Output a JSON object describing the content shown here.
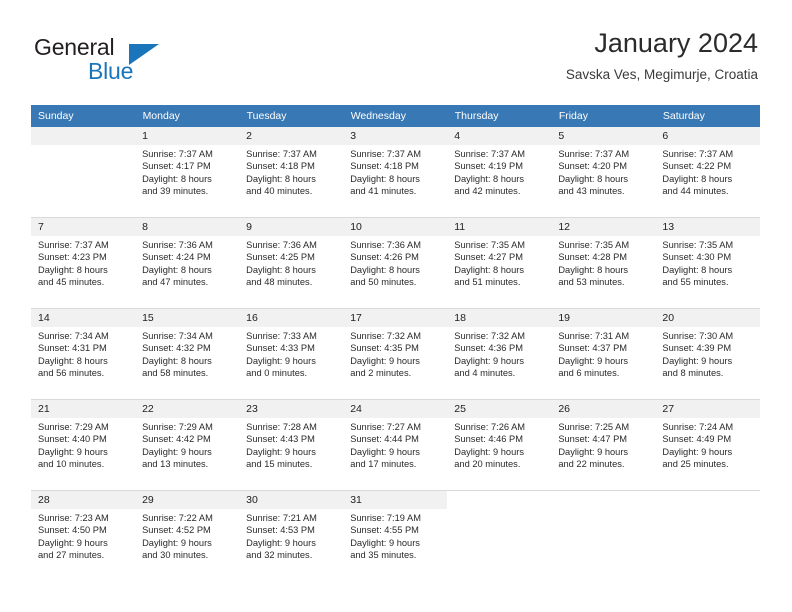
{
  "brand": {
    "word1": "General",
    "word2": "Blue",
    "triangle_color": "#1b75bb",
    "logo_icon": "general-blue-logo-icon"
  },
  "header": {
    "title": "January 2024",
    "subtitle": "Savska Ves, Megimurje, Croatia"
  },
  "theme": {
    "header_row_bg": "#3878b4",
    "header_row_text": "#ffffff",
    "daynum_bg": "#f1f1f1",
    "grid_line": "#d9d9d9",
    "body_text": "#2a2a2a"
  },
  "weekdays": [
    "Sunday",
    "Monday",
    "Tuesday",
    "Wednesday",
    "Thursday",
    "Friday",
    "Saturday"
  ],
  "weeks": [
    [
      {
        "day": "",
        "lines": []
      },
      {
        "day": "1",
        "lines": [
          "Sunrise: 7:37 AM",
          "Sunset: 4:17 PM",
          "Daylight: 8 hours",
          "and 39 minutes."
        ]
      },
      {
        "day": "2",
        "lines": [
          "Sunrise: 7:37 AM",
          "Sunset: 4:18 PM",
          "Daylight: 8 hours",
          "and 40 minutes."
        ]
      },
      {
        "day": "3",
        "lines": [
          "Sunrise: 7:37 AM",
          "Sunset: 4:18 PM",
          "Daylight: 8 hours",
          "and 41 minutes."
        ]
      },
      {
        "day": "4",
        "lines": [
          "Sunrise: 7:37 AM",
          "Sunset: 4:19 PM",
          "Daylight: 8 hours",
          "and 42 minutes."
        ]
      },
      {
        "day": "5",
        "lines": [
          "Sunrise: 7:37 AM",
          "Sunset: 4:20 PM",
          "Daylight: 8 hours",
          "and 43 minutes."
        ]
      },
      {
        "day": "6",
        "lines": [
          "Sunrise: 7:37 AM",
          "Sunset: 4:22 PM",
          "Daylight: 8 hours",
          "and 44 minutes."
        ]
      }
    ],
    [
      {
        "day": "7",
        "lines": [
          "Sunrise: 7:37 AM",
          "Sunset: 4:23 PM",
          "Daylight: 8 hours",
          "and 45 minutes."
        ]
      },
      {
        "day": "8",
        "lines": [
          "Sunrise: 7:36 AM",
          "Sunset: 4:24 PM",
          "Daylight: 8 hours",
          "and 47 minutes."
        ]
      },
      {
        "day": "9",
        "lines": [
          "Sunrise: 7:36 AM",
          "Sunset: 4:25 PM",
          "Daylight: 8 hours",
          "and 48 minutes."
        ]
      },
      {
        "day": "10",
        "lines": [
          "Sunrise: 7:36 AM",
          "Sunset: 4:26 PM",
          "Daylight: 8 hours",
          "and 50 minutes."
        ]
      },
      {
        "day": "11",
        "lines": [
          "Sunrise: 7:35 AM",
          "Sunset: 4:27 PM",
          "Daylight: 8 hours",
          "and 51 minutes."
        ]
      },
      {
        "day": "12",
        "lines": [
          "Sunrise: 7:35 AM",
          "Sunset: 4:28 PM",
          "Daylight: 8 hours",
          "and 53 minutes."
        ]
      },
      {
        "day": "13",
        "lines": [
          "Sunrise: 7:35 AM",
          "Sunset: 4:30 PM",
          "Daylight: 8 hours",
          "and 55 minutes."
        ]
      }
    ],
    [
      {
        "day": "14",
        "lines": [
          "Sunrise: 7:34 AM",
          "Sunset: 4:31 PM",
          "Daylight: 8 hours",
          "and 56 minutes."
        ]
      },
      {
        "day": "15",
        "lines": [
          "Sunrise: 7:34 AM",
          "Sunset: 4:32 PM",
          "Daylight: 8 hours",
          "and 58 minutes."
        ]
      },
      {
        "day": "16",
        "lines": [
          "Sunrise: 7:33 AM",
          "Sunset: 4:33 PM",
          "Daylight: 9 hours",
          "and 0 minutes."
        ]
      },
      {
        "day": "17",
        "lines": [
          "Sunrise: 7:32 AM",
          "Sunset: 4:35 PM",
          "Daylight: 9 hours",
          "and 2 minutes."
        ]
      },
      {
        "day": "18",
        "lines": [
          "Sunrise: 7:32 AM",
          "Sunset: 4:36 PM",
          "Daylight: 9 hours",
          "and 4 minutes."
        ]
      },
      {
        "day": "19",
        "lines": [
          "Sunrise: 7:31 AM",
          "Sunset: 4:37 PM",
          "Daylight: 9 hours",
          "and 6 minutes."
        ]
      },
      {
        "day": "20",
        "lines": [
          "Sunrise: 7:30 AM",
          "Sunset: 4:39 PM",
          "Daylight: 9 hours",
          "and 8 minutes."
        ]
      }
    ],
    [
      {
        "day": "21",
        "lines": [
          "Sunrise: 7:29 AM",
          "Sunset: 4:40 PM",
          "Daylight: 9 hours",
          "and 10 minutes."
        ]
      },
      {
        "day": "22",
        "lines": [
          "Sunrise: 7:29 AM",
          "Sunset: 4:42 PM",
          "Daylight: 9 hours",
          "and 13 minutes."
        ]
      },
      {
        "day": "23",
        "lines": [
          "Sunrise: 7:28 AM",
          "Sunset: 4:43 PM",
          "Daylight: 9 hours",
          "and 15 minutes."
        ]
      },
      {
        "day": "24",
        "lines": [
          "Sunrise: 7:27 AM",
          "Sunset: 4:44 PM",
          "Daylight: 9 hours",
          "and 17 minutes."
        ]
      },
      {
        "day": "25",
        "lines": [
          "Sunrise: 7:26 AM",
          "Sunset: 4:46 PM",
          "Daylight: 9 hours",
          "and 20 minutes."
        ]
      },
      {
        "day": "26",
        "lines": [
          "Sunrise: 7:25 AM",
          "Sunset: 4:47 PM",
          "Daylight: 9 hours",
          "and 22 minutes."
        ]
      },
      {
        "day": "27",
        "lines": [
          "Sunrise: 7:24 AM",
          "Sunset: 4:49 PM",
          "Daylight: 9 hours",
          "and 25 minutes."
        ]
      }
    ],
    [
      {
        "day": "28",
        "lines": [
          "Sunrise: 7:23 AM",
          "Sunset: 4:50 PM",
          "Daylight: 9 hours",
          "and 27 minutes."
        ]
      },
      {
        "day": "29",
        "lines": [
          "Sunrise: 7:22 AM",
          "Sunset: 4:52 PM",
          "Daylight: 9 hours",
          "and 30 minutes."
        ]
      },
      {
        "day": "30",
        "lines": [
          "Sunrise: 7:21 AM",
          "Sunset: 4:53 PM",
          "Daylight: 9 hours",
          "and 32 minutes."
        ]
      },
      {
        "day": "31",
        "lines": [
          "Sunrise: 7:19 AM",
          "Sunset: 4:55 PM",
          "Daylight: 9 hours",
          "and 35 minutes."
        ]
      },
      {
        "day": "",
        "lines": []
      },
      {
        "day": "",
        "lines": []
      },
      {
        "day": "",
        "lines": []
      }
    ]
  ]
}
